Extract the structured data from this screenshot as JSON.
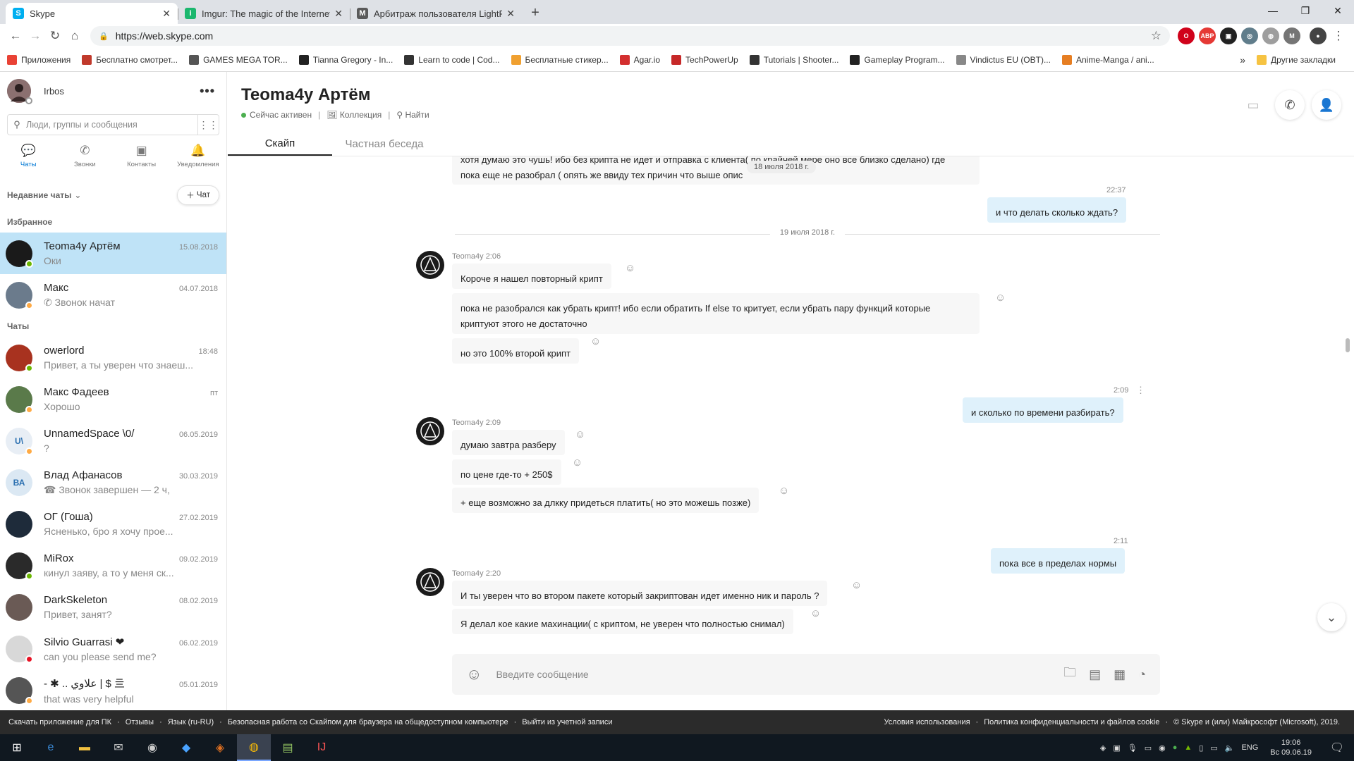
{
  "browser": {
    "tabs": [
      {
        "title": "Skype",
        "active": true,
        "favicon_color": "#00aff0"
      },
      {
        "title": "Imgur: The magic of the Internet",
        "active": false,
        "favicon_color": "#1bb76e"
      },
      {
        "title": "Арбитраж пользователя LightF",
        "active": false,
        "favicon_color": "#5a5a5a"
      }
    ],
    "url": "https://web.skype.com",
    "bookmarks": [
      {
        "label": "Приложения",
        "color": "#e94235"
      },
      {
        "label": "Бесплатно смотрет...",
        "color": "#c0392b"
      },
      {
        "label": "GAMES MEGA TOR...",
        "color": "#555555"
      },
      {
        "label": "Tianna Gregory - In...",
        "color": "#222222"
      },
      {
        "label": "Learn to code | Cod...",
        "color": "#333333"
      },
      {
        "label": "Бесплатные стикер...",
        "color": "#f0a030"
      },
      {
        "label": "Agar.io",
        "color": "#d32f2f"
      },
      {
        "label": "TechPowerUp",
        "color": "#c62828"
      },
      {
        "label": "Tutorials | Shooter...",
        "color": "#333333"
      },
      {
        "label": "Gameplay Program...",
        "color": "#222222"
      },
      {
        "label": "Vindictus EU (OBT)...",
        "color": "#888888"
      },
      {
        "label": "Anime-Manga / ani...",
        "color": "#e67e22"
      }
    ],
    "bookmarks_more": "»",
    "other_bookmarks": "Другие закладки"
  },
  "profile": {
    "name": "Irbos",
    "initials": ""
  },
  "search": {
    "placeholder": "Люди, группы и сообщения"
  },
  "nav": [
    {
      "label": "Чаты",
      "icon": "chat-icon",
      "glyph": "💬",
      "active": true
    },
    {
      "label": "Звонки",
      "icon": "phone-icon",
      "glyph": "✆",
      "active": false
    },
    {
      "label": "Контакты",
      "icon": "contacts-icon",
      "glyph": "▣",
      "active": false
    },
    {
      "label": "Уведомления",
      "icon": "bell-icon",
      "glyph": "🔔",
      "active": false
    }
  ],
  "recent": {
    "label": "Недавние чаты",
    "new_chat": "Чат"
  },
  "favorites_label": "Избранное",
  "chats_label": "Чаты",
  "favorites": [
    {
      "name": "Teoma4y Артём",
      "preview": "Оки",
      "date": "15.08.2018",
      "active": true,
      "avatar_color": "#1a1a1a",
      "initials": "",
      "status": "#6bb700"
    },
    {
      "name": "Макс",
      "preview": "✆ Звонок начат",
      "date": "04.07.2018",
      "active": false,
      "avatar_color": "#6b7b8c",
      "initials": "",
      "status": "#ffaa44"
    }
  ],
  "chats": [
    {
      "name": "owerlord",
      "preview": "Привет, а ты уверен что знаеш...",
      "date": "18:48",
      "avatar_color": "#a8321f",
      "initials": "",
      "status": "#6bb700"
    },
    {
      "name": "Макс Фадеев",
      "preview": "Хорошо",
      "date": "пт",
      "avatar_color": "#5a7a4a",
      "initials": "",
      "status": "#ffaa44"
    },
    {
      "name": "UnnamedSpace \\0/",
      "preview": "?",
      "date": "06.05.2019",
      "avatar_color": "#e8eef5",
      "initials": "U\\",
      "status": "#ffaa44"
    },
    {
      "name": "Влад Афанасов",
      "preview": "☎ Звонок завершен — 2 ч,",
      "date": "30.03.2019",
      "avatar_color": "#dbe8f3",
      "initials": "ВА",
      "status": ""
    },
    {
      "name": "ОГ (Гоша)",
      "preview": "Ясненько, бро я хочу прое...",
      "date": "27.02.2019",
      "avatar_color": "#1e2b3a",
      "initials": "",
      "status": ""
    },
    {
      "name": "MiRox",
      "preview": "кинул заяву, а то у меня ск...",
      "date": "09.02.2019",
      "avatar_color": "#2a2a2a",
      "initials": "",
      "status": "#6bb700"
    },
    {
      "name": "DarkSkeleton",
      "preview": "Привет, занят?",
      "date": "08.02.2019",
      "avatar_color": "#6a5a55",
      "initials": "",
      "status": ""
    },
    {
      "name": "Silvio Guarrasi ❤",
      "preview": "can you please send me?",
      "date": "06.02.2019",
      "avatar_color": "#d8d8d8",
      "initials": "",
      "status": "#e81123"
    },
    {
      "name": "- ✱ .. علاوي | $ 亖",
      "preview": "that was very helpful",
      "date": "05.01.2019",
      "avatar_color": "#555555",
      "initials": "",
      "status": "#ffaa44"
    }
  ],
  "conversation": {
    "title": "Teoma4y Артём",
    "status": "Сейчас активен",
    "gallery": "Коллекция",
    "find": "Найти",
    "tab_skype": "Скайп",
    "tab_private": "Частная беседа",
    "floating_date": "18 июля 2018 г.",
    "day_separator": "19 июля 2018 г.",
    "top_partial": [
      "хотя думаю это чушь! ибо без крипта не идет и отправка с клиента( по крайней мере оно все близко сделано) где",
      "пока еще не разобрал ( опять же ввиду тех причин что выше опис"
    ],
    "messages": [
      {
        "dir": "out",
        "stamp": "22:37",
        "text": "и что делать сколько ждать?"
      },
      {
        "dir": "in",
        "stamp": "Teoma4y 2:06",
        "text": "Короче я нашел повторный крипт"
      },
      {
        "dir": "in",
        "stamp": "",
        "text": "пока не разобрался как убрать крипт! ибо если обратить If else то критует, если убрать пару функций которые\nкриптуют этого не достаточно"
      },
      {
        "dir": "in",
        "stamp": "",
        "text": "но это 100% второй крипт"
      },
      {
        "dir": "out",
        "stamp": "2:09",
        "text": "и сколько по времени разбирать?"
      },
      {
        "dir": "in",
        "stamp": "Teoma4y 2:09",
        "text": "думаю завтра разберу"
      },
      {
        "dir": "in",
        "stamp": "",
        "text": "по цене где-то + 250$"
      },
      {
        "dir": "in",
        "stamp": "",
        "text": "+ еще возможно за длкку придеться платить( но это можешь позже)"
      },
      {
        "dir": "out",
        "stamp": "2:11",
        "text": "пока все в пределах нормы"
      },
      {
        "dir": "in",
        "stamp": "Teoma4y 2:20",
        "text": "И ты уверен что во втором пакете который закриптован идет именно ник и пароль ?"
      },
      {
        "dir": "in",
        "stamp": "",
        "text": "Я делал кое какие махинации( с криптом, не уверен что полностью снимал)"
      }
    ],
    "composer_placeholder": "Введите сообщение"
  },
  "footer": {
    "left": [
      "Скачать приложение для ПК",
      "Отзывы",
      "Язык (ru-RU)",
      "Безопасная работа со Скайпом для браузера на общедоступном компьютере",
      "Выйти из учетной записи"
    ],
    "right": [
      "Условия использования",
      "Политика конфиденциальности и файлов cookie",
      "© Skype и (или) Майкрософт (Microsoft), 2019."
    ]
  },
  "taskbar": {
    "lang": "ENG",
    "time": "19:06",
    "date": "Вс 09.06.19"
  },
  "colors": {
    "accent": "#0078d4",
    "active_chat": "#bfe3f7",
    "outgoing_bubble": "#dff1fb",
    "online": "#6bb700"
  }
}
